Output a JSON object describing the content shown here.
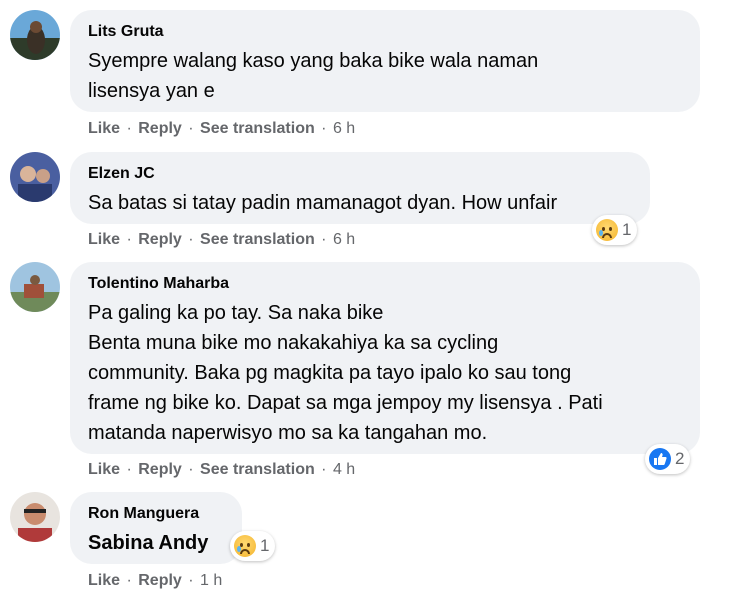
{
  "comments": [
    {
      "author": "Lits Gruta",
      "text": "Syempre walang kaso yang baka bike wala naman\nlisensya yan e",
      "actions": {
        "like": "Like",
        "reply": "Reply",
        "translate": "See translation",
        "time": "6 h"
      }
    },
    {
      "author": "Elzen JC",
      "text": "Sa batas si tatay padin mamanagot dyan. How unfair",
      "actions": {
        "like": "Like",
        "reply": "Reply",
        "translate": "See translation",
        "time": "6 h"
      },
      "reaction": {
        "icon": "sad-reaction-icon",
        "count": "1"
      }
    },
    {
      "author": "Tolentino Maharba",
      "text": "Pa galing ka po tay. Sa naka bike\nBenta muna bike mo nakakahiya ka sa cycling\ncommunity. Baka pg magkita pa tayo ipalo ko sau tong\nframe ng bike ko. Dapat sa mga jempoy my lisensya . Pati\nmatanda naperwisyo mo sa ka tangahan mo.",
      "actions": {
        "like": "Like",
        "reply": "Reply",
        "translate": "See translation",
        "time": "4 h"
      },
      "reaction": {
        "icon": "like-reaction-icon",
        "count": "2"
      }
    },
    {
      "author": "Ron Manguera",
      "text": "Sabina Andy",
      "actions": {
        "like": "Like",
        "reply": "Reply",
        "time": "1 h"
      },
      "reaction": {
        "icon": "sad-reaction-icon",
        "count": "1"
      }
    }
  ],
  "colors": {
    "bubble": "#f0f2f5",
    "meta_text": "#65676b",
    "like_blue": "#1877f2"
  }
}
